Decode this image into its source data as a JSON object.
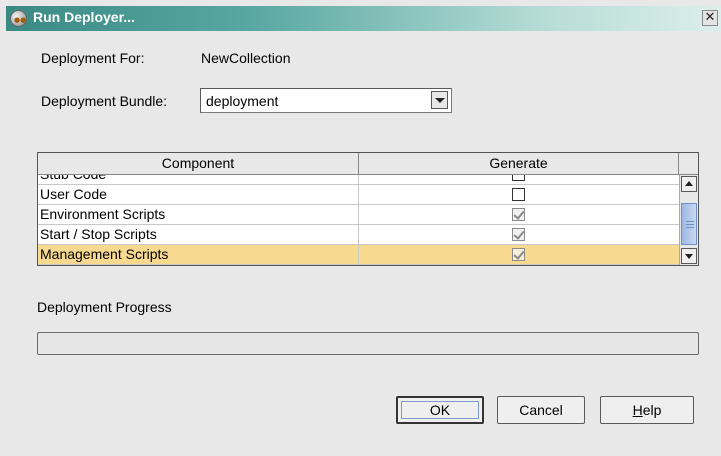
{
  "window": {
    "title": "Run Deployer...",
    "close_glyph": "✕",
    "icon": "app-cluster-icon"
  },
  "form": {
    "deployment_for_label": "Deployment For:",
    "deployment_for_value": "NewCollection",
    "bundle_label": "Deployment Bundle:",
    "bundle_value": "deployment"
  },
  "table": {
    "columns": [
      "Component",
      "Generate"
    ],
    "rows": [
      {
        "name": "Stub Code",
        "generate": false,
        "selected": false
      },
      {
        "name": "User Code",
        "generate": false,
        "selected": false
      },
      {
        "name": "Environment Scripts",
        "generate": true,
        "selected": false
      },
      {
        "name": "Start / Stop Scripts",
        "generate": true,
        "selected": false
      },
      {
        "name": "Management Scripts",
        "generate": true,
        "selected": true
      }
    ],
    "selected_row_color": "#f7d98f"
  },
  "progress": {
    "label": "Deployment Progress",
    "value_fraction": 0
  },
  "buttons": {
    "ok": "OK",
    "cancel": "Cancel",
    "help_mnemonic": "H",
    "help_rest": "elp"
  },
  "colors": {
    "titlebar_start": "#3a8a84",
    "titlebar_end": "#dcefea",
    "scrollbar_thumb": "#9fb7e0"
  }
}
